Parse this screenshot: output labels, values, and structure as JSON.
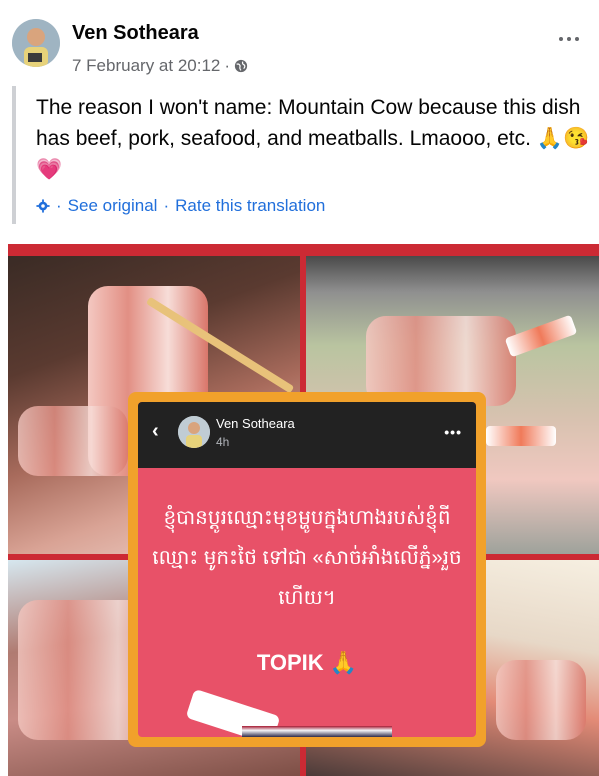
{
  "post": {
    "author": "Ven Sotheara",
    "timestamp": "7 February at 20:12",
    "separator": "·",
    "body": "The reason I won't name: Mountain Cow because this dish has beef, pork, seafood, and meatballs. Lmaooo, etc. 🙏😘💗",
    "see_original": "See original",
    "rate_translation": "Rate this translation",
    "dot": "·"
  },
  "overlay": {
    "author": "Ven Sotheara",
    "time": "4h",
    "khmer_text": "ខ្ញុំបានប្ដូរឈ្មោះមុខម្ហូបក្នុងហាងរបស់ខ្ញុំពីឈ្មោះ មូកះថៃ ទៅជា «សាច់អាំងលើភ្នំ»រួចហើយ។",
    "tag": "TOPIK 🙏"
  },
  "colors": {
    "link": "#216fdb",
    "muted": "#65676b",
    "card_border": "#f1a12b",
    "card_bg": "#e85168"
  },
  "icons": [
    "globe-icon",
    "more-dots-icon",
    "gear-icon",
    "back-chevron-icon"
  ]
}
